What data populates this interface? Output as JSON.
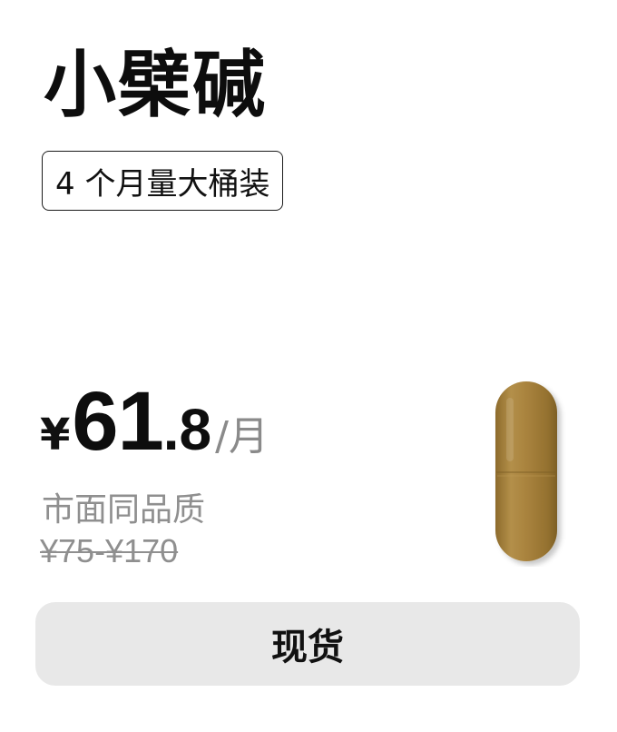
{
  "product": {
    "name": "小檗碱",
    "tag": "4 个月量大桶装"
  },
  "price": {
    "currency": "¥",
    "integer": "61",
    "decimal": ".8",
    "unit": "/月"
  },
  "market": {
    "label": "市面同品质",
    "range": "¥75-¥170"
  },
  "image": {
    "icon": "capsule-icon",
    "color": "#a9833e"
  },
  "button": {
    "label": "现货"
  }
}
